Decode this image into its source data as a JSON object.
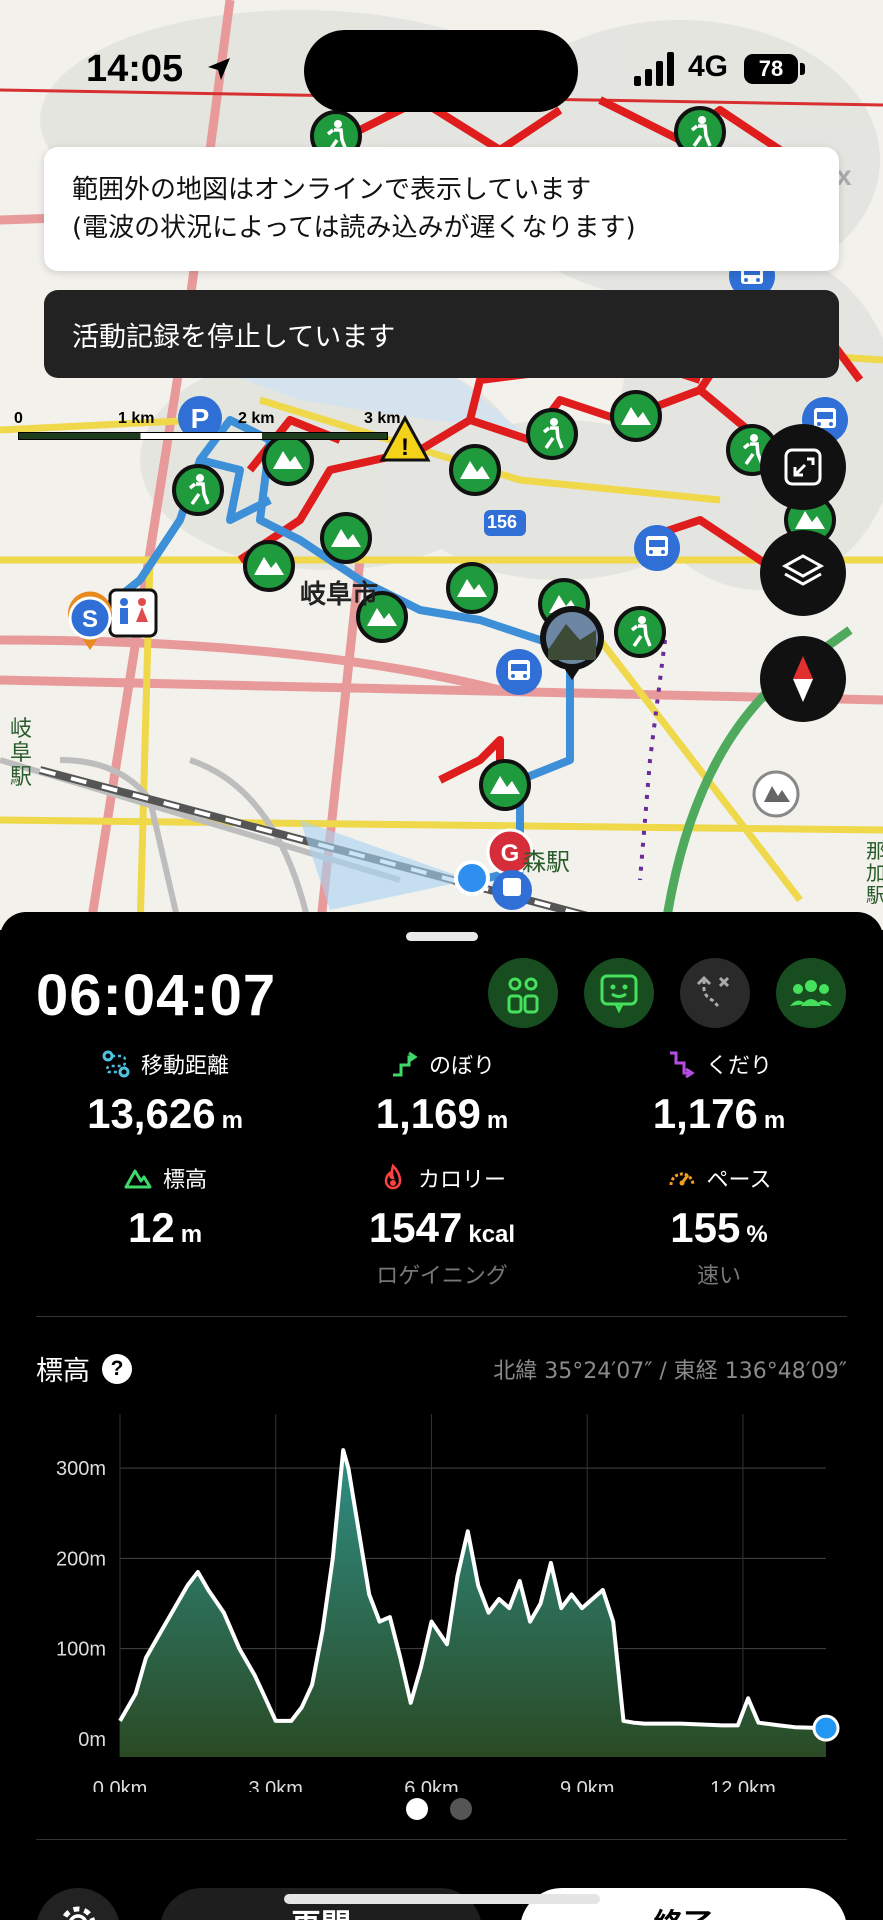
{
  "status_bar": {
    "time": "14:05",
    "network": "4G",
    "battery": "78"
  },
  "toasts": {
    "info_line1": "範囲外の地図はオンラインで表示しています",
    "info_line2": "(電波の状況によっては読み込みが遅くなります)",
    "recording_stopped": "活動記録を停止しています"
  },
  "map": {
    "scale": [
      "0",
      "1 km",
      "2 km",
      "3 km"
    ],
    "labels": {
      "city": "岐阜市",
      "station": "森駅",
      "route_num": "156",
      "gifu_station": [
        "岐",
        "阜",
        "駅"
      ],
      "right_edge": [
        "那",
        "加",
        "駅"
      ],
      "top_right": "x"
    },
    "icons": [
      "mountain-icon",
      "hiker-icon",
      "parking-icon",
      "bus-stop-icon",
      "restroom-icon",
      "warning-icon",
      "start-marker-icon",
      "goal-marker-icon",
      "photo-marker-icon",
      "current-location-icon"
    ],
    "buttons": [
      "fit-route-button",
      "layers-button",
      "compass-button"
    ]
  },
  "panel": {
    "elapsed": "06:04:07",
    "stats": {
      "distance": {
        "label": "移動距離",
        "value": "13,626",
        "unit": "m"
      },
      "ascent": {
        "label": "のぼり",
        "value": "1,169",
        "unit": "m"
      },
      "descent": {
        "label": "くだり",
        "value": "1,176",
        "unit": "m"
      },
      "altitude": {
        "label": "標高",
        "value": "12",
        "unit": "m"
      },
      "calories": {
        "label": "カロリー",
        "value": "1547",
        "unit": "kcal",
        "sub": "ロゲイニング"
      },
      "pace": {
        "label": "ペース",
        "value": "155",
        "unit": "%",
        "sub": "速い"
      }
    },
    "elevation": {
      "title": "標高",
      "coords": "北緯 35°24′07″ / 東経 136°48′09″"
    },
    "bottom": {
      "resume": "再開",
      "finish": "終了"
    }
  },
  "colors": {
    "accent_green": "#1f9a3c",
    "route_red": "#e01d1d",
    "route_blue": "#3d8fd8",
    "panel_bg": "#000000"
  },
  "chart_data": {
    "type": "area",
    "xlabel": "",
    "ylabel": "",
    "x_ticks": [
      "0.0km",
      "3.0km",
      "6.0km",
      "9.0km",
      "12.0km"
    ],
    "y_ticks": [
      "0m",
      "100m",
      "200m",
      "300m"
    ],
    "xlim": [
      0,
      13.6
    ],
    "ylim": [
      -20,
      360
    ],
    "x": [
      0,
      0.3,
      0.5,
      0.8,
      1.0,
      1.3,
      1.5,
      1.7,
      2.0,
      2.3,
      2.6,
      2.8,
      3.0,
      3.3,
      3.5,
      3.7,
      3.9,
      4.1,
      4.3,
      4.4,
      4.6,
      4.8,
      5.0,
      5.2,
      5.4,
      5.6,
      5.8,
      6.0,
      6.3,
      6.5,
      6.7,
      6.9,
      7.1,
      7.3,
      7.5,
      7.7,
      7.9,
      8.1,
      8.3,
      8.5,
      8.7,
      8.9,
      9.1,
      9.3,
      9.5,
      9.7,
      9.9,
      10.1,
      10.3,
      10.5,
      10.8,
      11.2,
      11.6,
      11.9,
      12.1,
      12.3,
      12.7,
      13.0,
      13.6
    ],
    "values": [
      20,
      50,
      90,
      120,
      140,
      170,
      185,
      165,
      140,
      100,
      70,
      45,
      20,
      20,
      35,
      60,
      120,
      200,
      320,
      300,
      230,
      160,
      130,
      135,
      90,
      40,
      80,
      130,
      105,
      180,
      230,
      170,
      140,
      155,
      145,
      175,
      130,
      150,
      195,
      145,
      160,
      145,
      155,
      165,
      130,
      20,
      18,
      17,
      17,
      17,
      17,
      16,
      15,
      15,
      45,
      18,
      15,
      13,
      12
    ]
  }
}
